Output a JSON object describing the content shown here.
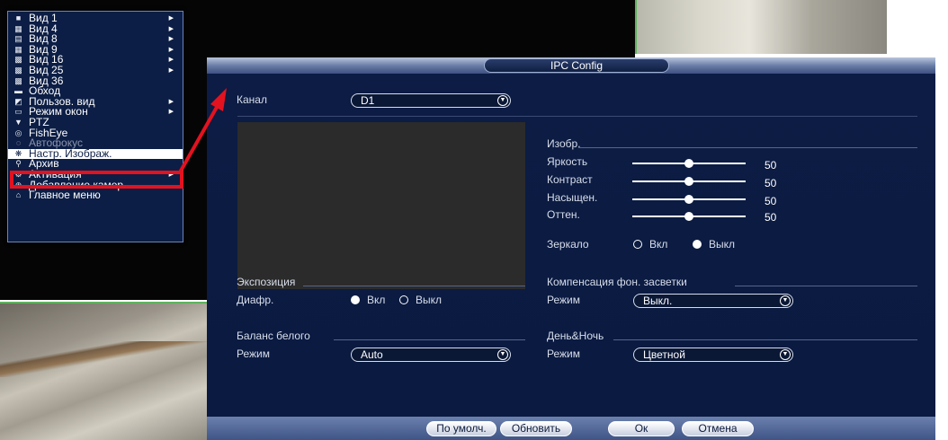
{
  "dialog": {
    "title": "IPC Config",
    "channel_label": "Канал",
    "channel_value": "D1",
    "image_section": "Изобр.",
    "brightness_label": "Яркость",
    "brightness_value": "50",
    "contrast_label": "Контраст",
    "contrast_value": "50",
    "saturation_label": "Насыщен.",
    "saturation_value": "50",
    "hue_label": "Оттен.",
    "hue_value": "50",
    "mirror_label": "Зеркало",
    "on_label": "Вкл",
    "off_label": "Выкл",
    "exposure_section": "Экспозиция",
    "iris_label": "Диафр.",
    "backlight_section": "Компенсация фон. засветки",
    "mode_label": "Режим",
    "backlight_mode_value": "Выкл.",
    "wb_section": "Баланс белого",
    "wb_mode_value": "Auto",
    "daynight_section": "День&Ночь",
    "daynight_mode_value": "Цветной",
    "btn_default": "По умолч.",
    "btn_refresh": "Обновить",
    "btn_ok": "Ок",
    "btn_cancel": "Отмена",
    "slider_levels": [
      50,
      50,
      50,
      50
    ],
    "mirror_on": false,
    "iris_on": true
  },
  "context_menu": {
    "items": [
      {
        "icon": "view1-icon",
        "label": "Вид 1",
        "submenu": true
      },
      {
        "icon": "view4-icon",
        "label": "Вид 4",
        "submenu": true
      },
      {
        "icon": "view8-icon",
        "label": "Вид 8",
        "submenu": true
      },
      {
        "icon": "view9-icon",
        "label": "Вид 9",
        "submenu": true
      },
      {
        "icon": "view16-icon",
        "label": "Вид 16",
        "submenu": true
      },
      {
        "icon": "view25-icon",
        "label": "Вид 25",
        "submenu": true
      },
      {
        "icon": "view36-icon",
        "label": "Вид 36",
        "submenu": false
      },
      {
        "icon": "tour-icon",
        "label": "Обход",
        "submenu": false
      },
      {
        "icon": "custom-view-icon",
        "label": "Пользов. вид",
        "submenu": true
      },
      {
        "icon": "window-mode-icon",
        "label": "Режим окон",
        "submenu": true
      },
      {
        "icon": "ptz-icon",
        "label": "PTZ",
        "submenu": false
      },
      {
        "icon": "fisheye-icon",
        "label": "FishEye",
        "submenu": false
      },
      {
        "icon": "autofocus-icon",
        "label": "Автофокус",
        "submenu": false
      },
      {
        "icon": "image-settings-icon",
        "label": "Настр. Изображ.",
        "submenu": false
      },
      {
        "icon": "search-icon",
        "label": "Архив",
        "submenu": false
      },
      {
        "icon": "activation-icon",
        "label": "Активация",
        "submenu": true
      },
      {
        "icon": "add-camera-icon",
        "label": "Добавление камер",
        "submenu": false
      },
      {
        "icon": "home-icon",
        "label": "Главное меню",
        "submenu": false
      }
    ],
    "highlighted": "Настр. Изображ."
  },
  "colors": {
    "dialog_bg": "#0c1c44",
    "menu_bg": "#0c1e45",
    "annotation_red": "#e3121f"
  }
}
